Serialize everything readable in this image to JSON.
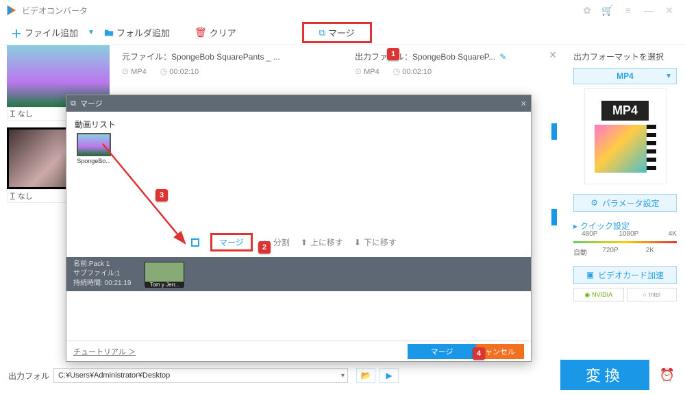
{
  "app": {
    "title": "ビデオコンバータ"
  },
  "toolbar": {
    "add_file": "ファイル追加",
    "add_folder": "フォルダ追加",
    "clear": "クリア",
    "merge": "マージ"
  },
  "thumbs": {
    "nashi": "なし"
  },
  "file_info": {
    "src_label": "元ファイル：",
    "src_name": "SpongeBob SquarePants _ ...",
    "out_label": "出力ファイル：",
    "out_name": "SpongeBob SquareP...",
    "format": "MP4",
    "duration": "00:02:10"
  },
  "right": {
    "format_title": "出力フォーマットを選択",
    "mp4": "MP4",
    "param": "パラメータ設定",
    "quick": "クイック設定",
    "q480": "480P",
    "q1080": "1080P",
    "q4k": "4K",
    "qauto": "自動",
    "q720": "720P",
    "q2k": "2K",
    "gpu": "ビデオカード加速",
    "nvidia": "NVIDIA",
    "intel": "Intel"
  },
  "footer": {
    "out_folder_label": "出力フォル",
    "out_path": "C:¥Users¥Administrator¥Desktop",
    "convert": "変換"
  },
  "dialog": {
    "title": "マージ",
    "list_label": "動画リスト",
    "item_name": "SpongeBo...",
    "tb_merge": "マージ",
    "tb_split": "分割",
    "tb_up": "上に移す",
    "tb_down": "下に移す",
    "pack_name": "名前:Pack 1",
    "pack_sub": "サブファイル:1",
    "pack_dur": "持続時間: 00:21:19",
    "pack_thumb": "Tom y Jerr...",
    "tutorial": "チュートリアル ＞",
    "btn_merge": "マージ",
    "btn_cancel": "ャンセル"
  },
  "badges": {
    "b1": "1",
    "b2": "2",
    "b3": "3",
    "b4": "4"
  }
}
